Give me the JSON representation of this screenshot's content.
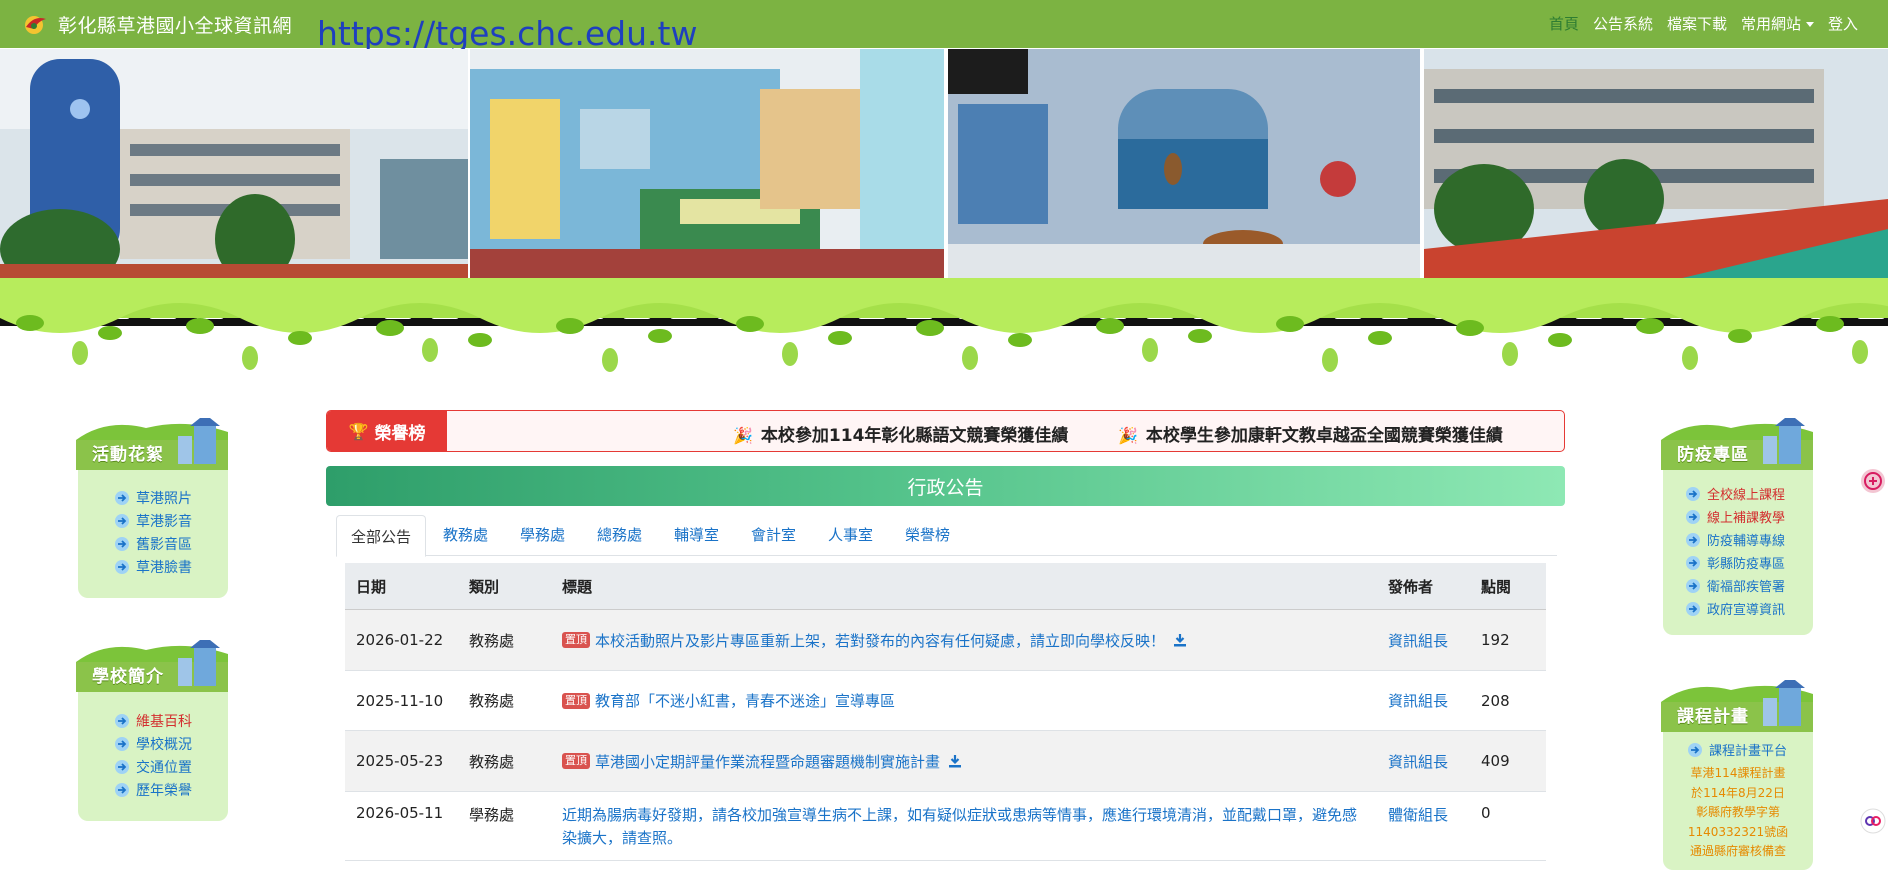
{
  "nav": {
    "site_title": "彰化縣草港國小全球資訊網",
    "url_overlay": "https://tges.chc.edu.tw",
    "links": [
      {
        "label": "首頁",
        "active": true
      },
      {
        "label": "公告系統"
      },
      {
        "label": "檔案下載"
      },
      {
        "label": "常用網站"
      },
      {
        "label": "登入"
      }
    ]
  },
  "left_sidebar": [
    {
      "title": "活動花絮",
      "items": [
        {
          "label": "草港照片"
        },
        {
          "label": "草港影音"
        },
        {
          "label": "舊影音區"
        },
        {
          "label": "草港臉書"
        }
      ]
    },
    {
      "title": "學校簡介",
      "items": [
        {
          "label": "維基百科",
          "red": true
        },
        {
          "label": "學校概況"
        },
        {
          "label": "交通位置"
        },
        {
          "label": "歷年榮譽"
        }
      ]
    }
  ],
  "right_sidebar": [
    {
      "title": "防疫專區",
      "items": [
        {
          "label": "全校線上課程",
          "red": true
        },
        {
          "label": "線上補課教學",
          "red": true
        },
        {
          "label": "防疫輔導專線"
        },
        {
          "label": "彰縣防疫專區"
        },
        {
          "label": "衛福部疾管署"
        },
        {
          "label": "政府宣導資訊"
        }
      ]
    },
    {
      "title": "課程計畫",
      "items": [
        {
          "label": "課程計畫平台"
        }
      ],
      "note": [
        "草港114課程計畫",
        "於114年8月22日",
        "彰縣府教學字第",
        "1140332321號函",
        "通過縣府審核備查"
      ]
    }
  ],
  "honor": {
    "label": "榮譽榜",
    "items": [
      "本校參加114年彰化縣語文競賽榮獲佳績",
      "本校學生參加康軒文教卓越盃全國競賽榮獲佳績"
    ]
  },
  "announcements": {
    "header": "行政公告",
    "tabs": [
      "全部公告",
      "教務處",
      "學務處",
      "總務處",
      "輔導室",
      "會計室",
      "人事室",
      "榮譽榜"
    ],
    "columns": {
      "date": "日期",
      "category": "類別",
      "title": "標題",
      "publisher": "發佈者",
      "hits": "點閱"
    },
    "pin_label": "置頂",
    "rows": [
      {
        "date": "2026-01-22",
        "category": "教務處",
        "pinned": true,
        "title": "本校活動照片及影片專區重新上架，若對發布的內容有任何疑慮，請立即向學校反映！",
        "download": true,
        "publisher": "資訊組長",
        "hits": "192"
      },
      {
        "date": "2025-11-10",
        "category": "教務處",
        "pinned": true,
        "title": "教育部「不迷小紅書，青春不迷途」宣導專區",
        "download": false,
        "publisher": "資訊組長",
        "hits": "208"
      },
      {
        "date": "2025-05-23",
        "category": "教務處",
        "pinned": true,
        "title": "草港國小定期評量作業流程暨命題審題機制實施計畫",
        "download": true,
        "publisher": "資訊組長",
        "hits": "409"
      },
      {
        "date": "2026-05-11",
        "category": "學務處",
        "pinned": false,
        "title_line1": "近期為腸病毒好發期，請各校加強宣導生病不上課，如有疑似症狀或患病等情事，應進行環境清消，並配戴口罩，避免感",
        "title_line2": "染擴大，請查照。",
        "download": false,
        "publisher": "體衛組長",
        "hits": "0"
      }
    ]
  },
  "colors": {
    "nav_green": "#7cb342",
    "link_blue": "#1a73c8",
    "honor_red": "#e53935",
    "panel_green": "#d9f3c4"
  }
}
